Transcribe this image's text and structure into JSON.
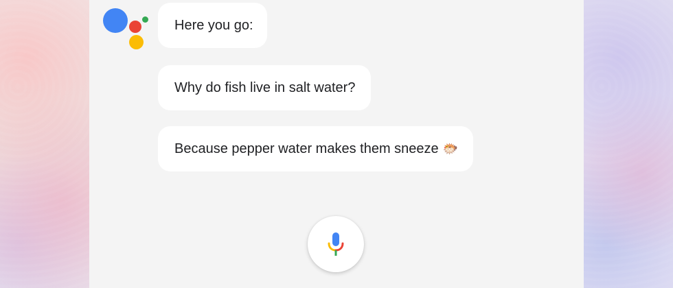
{
  "conversation": {
    "messages": [
      {
        "text": "Here you go:"
      },
      {
        "text": "Why do fish live in salt water?"
      },
      {
        "text": "Because pepper water makes them sneeze",
        "emoji": "🐡"
      }
    ]
  },
  "assistant_logo": {
    "icon": "google-assistant-dots-icon",
    "colors": {
      "blue": "#4285F4",
      "red": "#EA4335",
      "yellow": "#FBBC05",
      "green": "#34A853"
    }
  },
  "mic_button": {
    "icon": "microphone-icon",
    "colors": {
      "body": "#4285F4",
      "stand_left": "#FBBC05",
      "stand_right": "#EA4335",
      "base": "#34A853"
    }
  }
}
